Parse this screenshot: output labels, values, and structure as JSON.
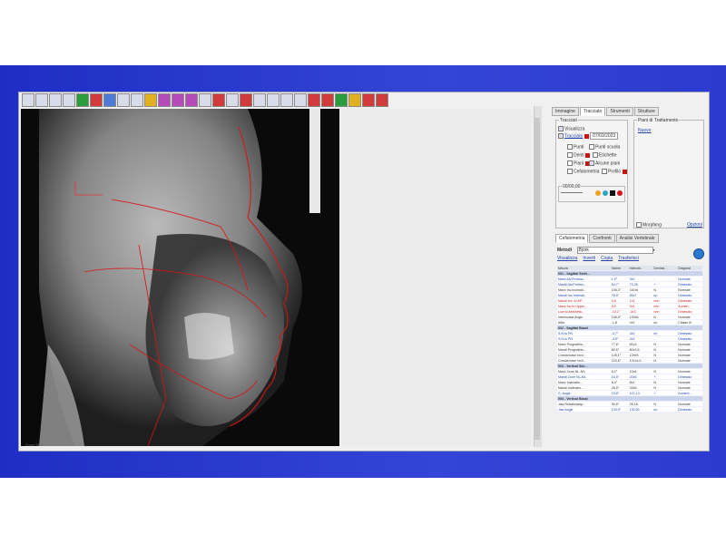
{
  "right_panel": {
    "tabs": [
      "Immagine",
      "Tracciato",
      "Strumenti",
      "Strutture"
    ],
    "active_tab": "Tracciato",
    "tracciati_group": "Tracciati",
    "visualizza": "Visualizza",
    "tracciato_link": "Tracciato",
    "tracciato_date": "07/03/2023",
    "punti": "Punti",
    "punti_scuola": "Punti scuola",
    "denti": "Denti",
    "etichette": "Etichette",
    "piani": "Piani",
    "abcune_piani": "Alcune piani",
    "cefalometria": "Cefalometria",
    "profilo": "Profilo",
    "opacity_group": "00/00,00",
    "morphing": "Morphing",
    "morphing_link": "Opzioni",
    "piani_group": "Piani di Trattamento",
    "nuovo": "Nuovo",
    "lower_tabs": [
      "Cefalometria",
      "Confronti",
      "Analisi Vertebrale"
    ],
    "metodi_label": "Metodi",
    "metodi_value": "Björk",
    "links": [
      "Visualizza",
      "Inverti",
      "Copia",
      "Trasferisci"
    ],
    "table_headers": [
      "Misura",
      "Valore",
      "Interval...",
      "Deviazi...",
      "Diagnosi"
    ],
    "rows": [
      {
        "sec": true,
        "cells": [
          "001 - Sagittal Skelt...",
          "",
          "",
          "",
          ""
        ]
      },
      {
        "c": "blue",
        "cells": [
          "Maxx Alv.Protrusi...",
          "1,9°",
          "3±2",
          "-",
          "Normale"
        ]
      },
      {
        "c": "blue",
        "cells": [
          "Mandi Alv.Protrus...",
          "64,7°",
          "73-25",
          "+",
          "Dimesato"
        ]
      },
      {
        "c": "dark",
        "cells": [
          "Maxx Inc.Inclinati...",
          "106,3°",
          "110±6",
          "N",
          "Normale"
        ]
      },
      {
        "c": "blue",
        "cells": [
          "Mandi Inc.Inclinati...",
          "78,5°",
          "89±7",
          "nn",
          "Dimesato"
        ]
      },
      {
        "c": "red",
        "cells": [
          "Mandi Inc. to AP...",
          "0,8",
          "1±1",
          "nnn",
          "Dimesato"
        ]
      },
      {
        "c": "red",
        "cells": [
          "Maxx Inc to Upper...",
          "8,9",
          "3±1",
          "nnn",
          "Aumen..."
        ]
      },
      {
        "c": "red",
        "cells": [
          "Low to Aesthetic...",
          "-10,1°",
          "-3±3",
          "nnn",
          "Dimesato"
        ]
      },
      {
        "c": "dark",
        "cells": [
          "Interincisal Angle",
          "108,5°",
          "130±6",
          "N",
          "Normale"
        ]
      },
      {
        "c": "dark",
        "cells": [
          "Wits",
          "-1,8",
          "0±2",
          "nn",
          "Classe III"
        ]
      },
      {
        "sec": true,
        "cells": [
          "002 - Sagittal Basal",
          "",
          "",
          "",
          ""
        ]
      },
      {
        "c": "blue",
        "cells": [
          "S.N.to PN",
          "-4,7°",
          "3±2",
          "nn",
          "Dimesato"
        ]
      },
      {
        "c": "blue",
        "cells": [
          "S.N.to PN",
          "-3,9°",
          "3±2",
          "-",
          "Dimesato"
        ]
      },
      {
        "c": "dark",
        "cells": [
          "Maxx Prognathis...",
          "77,6°",
          "81±3",
          "N",
          "Normale"
        ]
      },
      {
        "c": "dark",
        "cells": [
          "Mandi Prognathis...",
          "80,6°",
          "80±3,5",
          "N",
          "Normale"
        ]
      },
      {
        "c": "dark",
        "cells": [
          "Cranial base Incli...",
          "128,1°",
          "129±5",
          "N",
          "Normale"
        ]
      },
      {
        "c": "dark",
        "cells": [
          "Cranial base Incli...",
          "123,6°",
          "131±4,5",
          "N",
          "Normale"
        ]
      },
      {
        "sec": true,
        "cells": [
          "003 - Vertical Ske...",
          "",
          "",
          "",
          ""
        ]
      },
      {
        "c": "dark",
        "cells": [
          "Maxx Zone NL-NS",
          "6,2°",
          "10±4",
          "N",
          "Normale"
        ]
      },
      {
        "c": "blue",
        "cells": [
          "Mandi Zone NL-ML",
          "16,5°",
          "20±5",
          "+",
          "Dimesato"
        ]
      },
      {
        "c": "dark",
        "cells": [
          "Maxx Inclinatio...",
          "8,0°",
          "8±1",
          "N",
          "Normale"
        ]
      },
      {
        "c": "dark",
        "cells": [
          "Mandi Inclinatio...",
          "28,5°",
          "33±6",
          "N",
          "Normale"
        ]
      },
      {
        "c": "blue",
        "cells": [
          "G. Angle",
          "15,8°",
          "107-13",
          "+",
          "Aument..."
        ]
      },
      {
        "sec": true,
        "cells": [
          "004 - Vertical Basal",
          "",
          "",
          "",
          ""
        ]
      },
      {
        "c": "dark",
        "cells": [
          "Jaw Relationship...",
          "30,6°",
          "25-16",
          "N",
          "Normale"
        ]
      },
      {
        "c": "blue",
        "cells": [
          "Jaw Angle",
          "109,9°",
          "130,50",
          "nn",
          "Dimesato"
        ]
      }
    ]
  },
  "statusbar": {
    "text": "Zoom 55%"
  },
  "icons": [
    "new-icon",
    "open-icon",
    "undo-icon",
    "redo-icon",
    "move-icon",
    "rotate-icon",
    "draw-icon",
    "measure-icon",
    "brightness-icon",
    "contrast-icon",
    "flip-icon",
    "split-icon",
    "split-icon",
    "cursor-icon",
    "cloud-icon",
    "erase-icon",
    "stop-icon",
    "save-icon",
    "print-icon",
    "export-icon",
    "image-icon",
    "close-icon",
    "pdf-icon",
    "check-icon",
    "info-icon",
    "exit-icon",
    "door-icon"
  ]
}
